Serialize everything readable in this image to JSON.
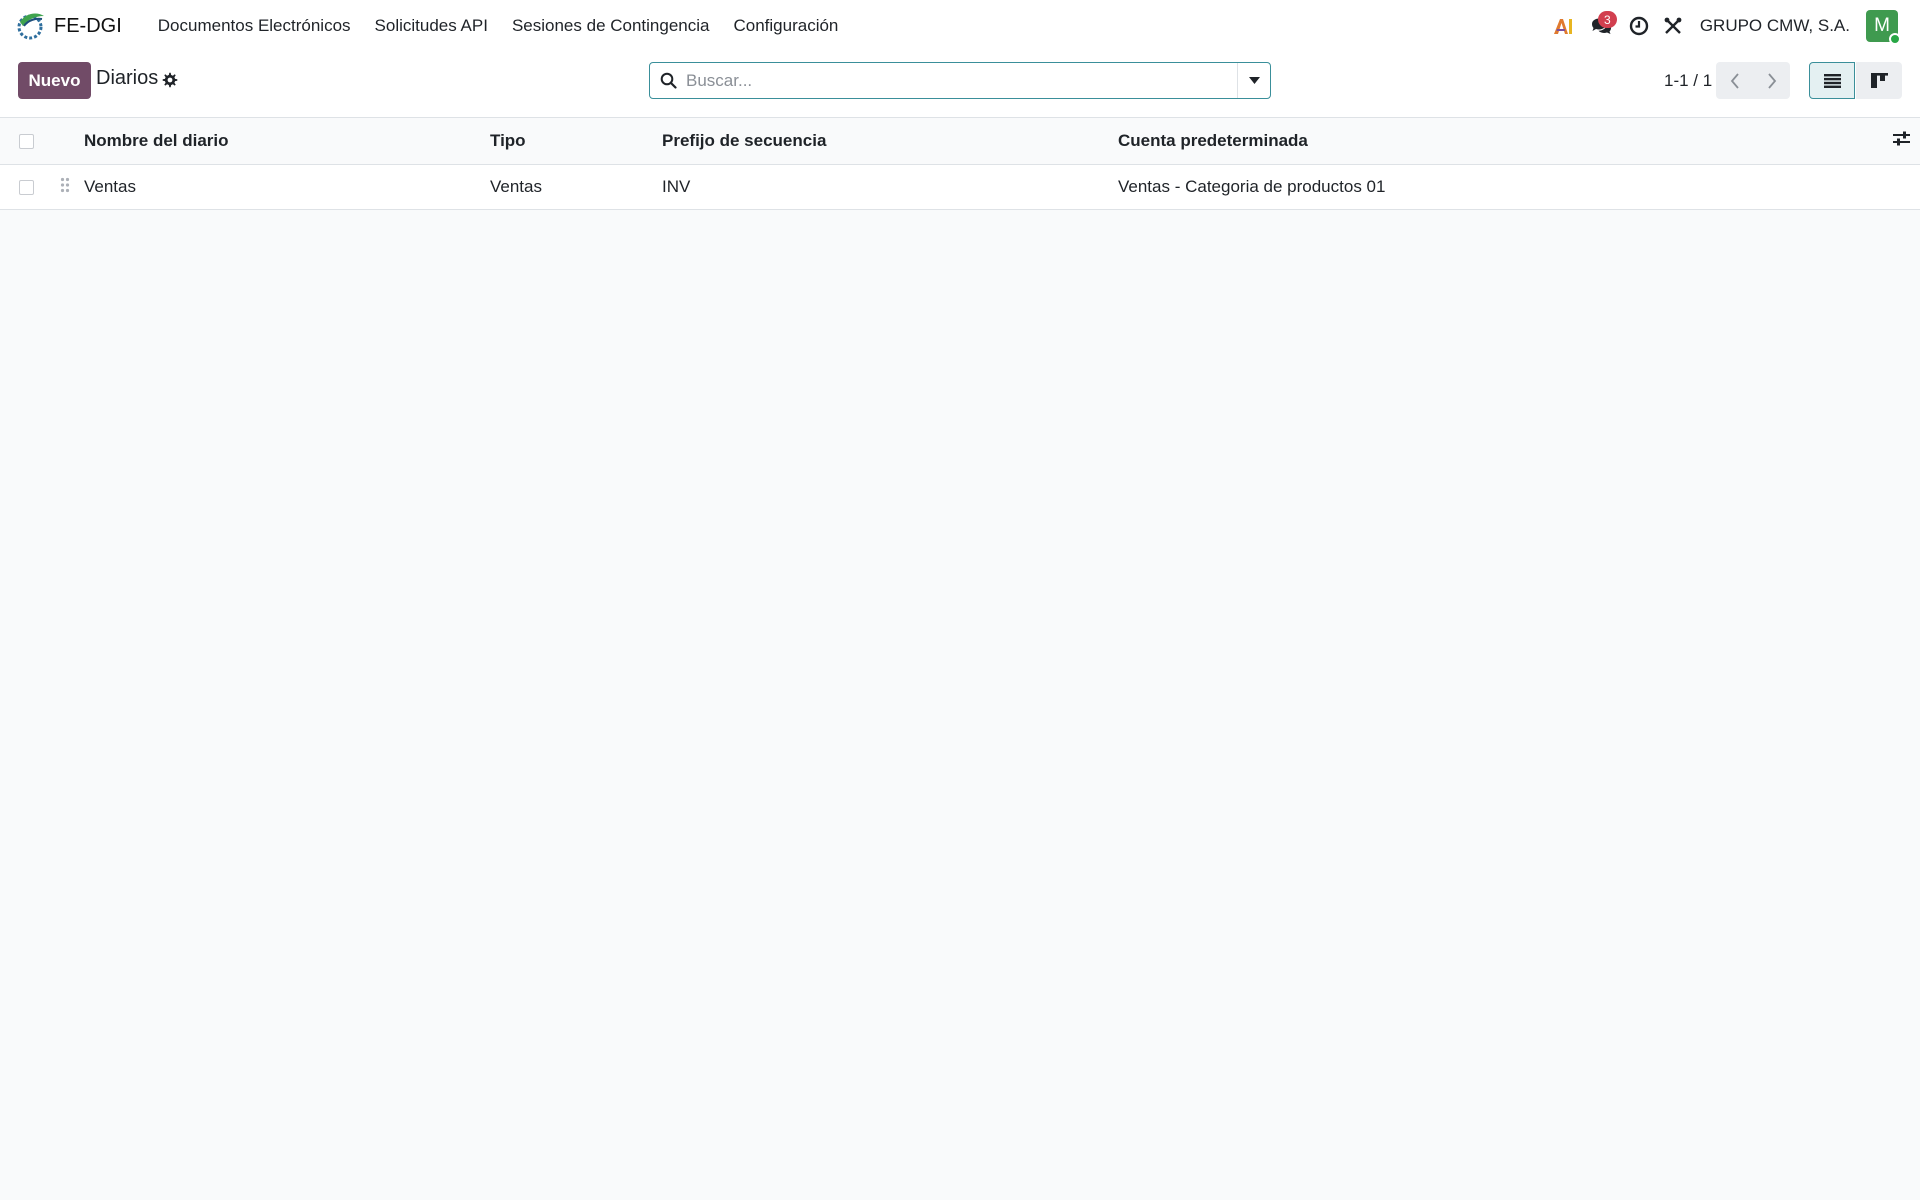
{
  "navbar": {
    "app_name": "FE-DGI",
    "menu": [
      {
        "label": "Documentos Electrónicos"
      },
      {
        "label": "Solicitudes API"
      },
      {
        "label": "Sesiones de Contingencia"
      },
      {
        "label": "Configuración"
      }
    ],
    "icons": [
      "ai-icon",
      "chat-icon",
      "clock-icon",
      "tools-icon"
    ],
    "messages_badge": "3",
    "company": "GRUPO CMW, S.A.",
    "avatar_initial": "M"
  },
  "control_panel": {
    "new_label": "Nuevo",
    "title": "Diarios",
    "search_placeholder": "Buscar...",
    "pager": "1-1 / 1"
  },
  "table": {
    "columns": [
      "Nombre del diario",
      "Tipo",
      "Prefijo de secuencia",
      "Cuenta predeterminada"
    ],
    "rows": [
      {
        "name": "Ventas",
        "type": "Ventas",
        "prefix": "INV",
        "account": "Ventas - Categoria de productos 01"
      }
    ]
  },
  "colors": {
    "primary": "#714b67",
    "accent": "#3a8f9a",
    "badge": "#d23f4f",
    "avatar": "#3f9a4f"
  }
}
